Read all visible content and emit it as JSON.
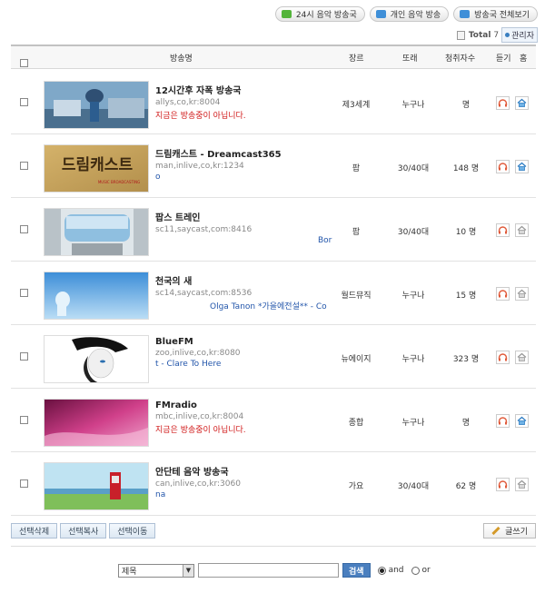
{
  "top_tabs": [
    {
      "label": "24시 음악 방송국",
      "icon": "music-icon",
      "color": "#53b43a"
    },
    {
      "label": "개인 음악 방송",
      "icon": "music-note-icon",
      "color": "#3f8fd8"
    },
    {
      "label": "방송국 전체보기",
      "icon": "list-icon",
      "color": "#3f8fd8"
    }
  ],
  "total": {
    "label": "Total",
    "count": "7",
    "admin_label": "관리자"
  },
  "columns": {
    "name": "방송명",
    "genre": "장르",
    "age": "또래",
    "listeners": "청취자수",
    "listen": "듣기",
    "home": "홈"
  },
  "rows": [
    {
      "title": "12시간후 자폭 방송국",
      "address": "allys,co,kr:8004",
      "message": "지금은 방송중이 아닙니다.",
      "message_color": "red",
      "genre": "제3세계",
      "age": "누구나",
      "listeners": "명"
    },
    {
      "title": "드림캐스트 - Dreamcast365",
      "address": "man,inlive,co,kr:1234",
      "message": "o",
      "message_color": "blue",
      "genre": "팝",
      "age": "30/40대",
      "listeners": "148 명",
      "thumb_text": "드림캐스트",
      "thumb_sub": "MUSIC BROADCASTING"
    },
    {
      "title": "팝스 트레인",
      "address": "sc11,saycast,com:8416",
      "message": "Bor",
      "message_color": "blue",
      "genre": "팝",
      "age": "30/40대",
      "listeners": "10 명"
    },
    {
      "title": "천국의 새",
      "address": "sc14,saycast,com:8536",
      "message": "Olga Tanon *가을에전설** - Co",
      "message_color": "blue",
      "genre": "월드뮤직",
      "age": "누구나",
      "listeners": "15 명"
    },
    {
      "title": "BlueFM",
      "address": "zoo,inlive,co,kr:8080",
      "message": "t - Clare To Here",
      "message_color": "blue",
      "genre": "뉴에이지",
      "age": "누구나",
      "listeners": "323 명"
    },
    {
      "title": "FMradio",
      "address": "mbc,inlive,co,kr:8004",
      "message": "지금은 방송중이 아닙니다.",
      "message_color": "red",
      "genre": "종합",
      "age": "누구나",
      "listeners": "명"
    },
    {
      "title": "안단테 음악 방송국",
      "address": "can,inlive,co,kr:3060",
      "message": "na",
      "message_color": "blue",
      "genre": "가요",
      "age": "30/40대",
      "listeners": "62 명"
    }
  ],
  "bottom_buttons": [
    "선택삭제",
    "선택복사",
    "선택이동"
  ],
  "write_button": "글쓰기",
  "search": {
    "select_value": "제목",
    "input_value": "",
    "button": "검색",
    "radio_and": "and",
    "radio_or": "or",
    "selected": "and"
  },
  "colors": {
    "accent_blue": "#4a7fbf",
    "red_text": "#d01818",
    "blue_text": "#2255aa"
  }
}
